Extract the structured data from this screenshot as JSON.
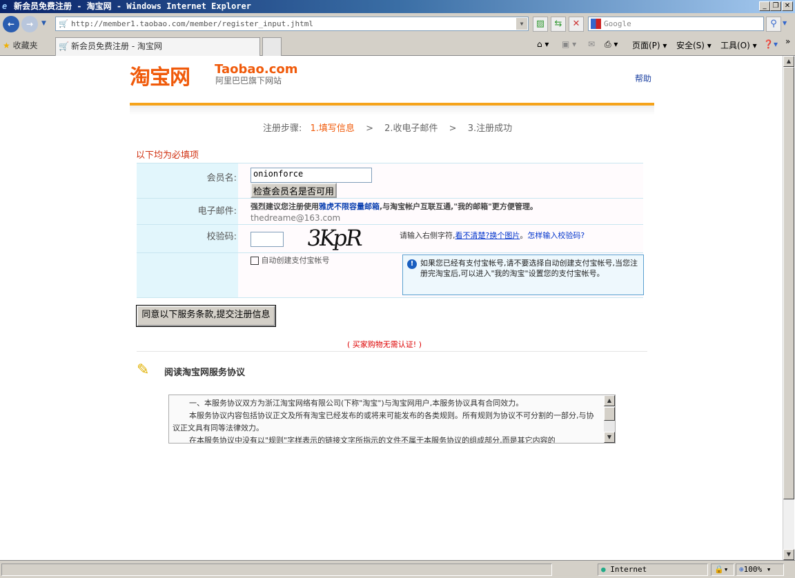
{
  "window": {
    "title": "新会员免费注册 - 淘宝网 - Windows Internet Explorer"
  },
  "browser": {
    "url": "http://member1.taobao.com/member/register_input.jhtml",
    "search_placeholder": "Google",
    "favorites": "收藏夹",
    "tab_title": "新会员免费注册 - 淘宝网",
    "menu": {
      "page": "页面(P)",
      "safety": "安全(S)",
      "tools": "工具(O)"
    },
    "status": {
      "zone": "Internet",
      "zoom": "100%"
    }
  },
  "page": {
    "logo": {
      "cn": "淘宝网",
      "en": "Taobao.com",
      "sub": "阿里巴巴旗下网站"
    },
    "help": "帮助",
    "steps": {
      "label": "注册步骤:",
      "s1": "1.填写信息",
      "sep": ">",
      "s2": "2.收电子邮件",
      "s3": "3.注册成功"
    },
    "required_note": "以下均为必填项",
    "form": {
      "username_label": "会员名:",
      "username_value": "onionforce",
      "check_button": "检查会员名是否可用",
      "email_label": "电子邮件:",
      "email_tip_pre": "强烈建议您注册使用",
      "email_tip_link": "雅虎不限容量邮箱",
      "email_tip_post": ",与淘宝帐户互联互通,\"我的邮箱\"更方便管理。",
      "email_value": "thedreame@163.com",
      "captcha_label": "校验码:",
      "captcha_image_text": "3KpR",
      "captcha_hint": "请输入右侧字符,",
      "captcha_refresh": "看不清楚?换个图片",
      "captcha_howto": "怎样输入校验码?",
      "alipay_checkbox": "自动创建支付宝帐号",
      "alipay_checked": false,
      "alipay_info": "如果您已经有支付宝帐号,请不要选择自动创建支付宝帐号,当您注册完淘宝后,可以进入\"我的淘宝\"设置您的支付宝帐号。"
    },
    "submit": "同意以下服务条款,提交注册信息",
    "buyer_note": "( 买家购物无需认证! )",
    "agreement_title": "阅读淘宝网服务协议",
    "agreement": [
      "一、本服务协议双方为浙江淘宝网络有限公司(下称\"淘宝\")与淘宝网用户,本服务协议具有合同效力。",
      "本服务协议内容包括协议正文及所有淘宝已经发布的或将来可能发布的各类规则。所有规则为协议不可分割的一部分,与协议正文具有同等法律效力。",
      "在本服务协议中没有以\"规则\"字样表示的链接文字所指示的文件不属于本服务协议的组成部分,而是其它内容的"
    ]
  }
}
